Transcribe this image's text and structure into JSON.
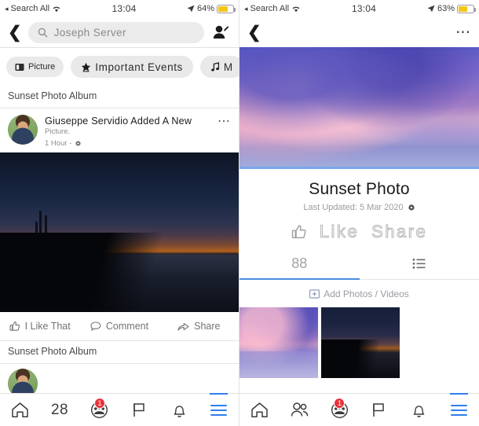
{
  "left": {
    "status": {
      "carrier": "Search All",
      "wifi_icon": "wifi-icon",
      "time": "13:04",
      "location_icon": "location-arrow-icon",
      "battery_pct": "64%",
      "battery_level": 64
    },
    "nav": {
      "back_icon": "chevron-left-icon",
      "search_value": "Joseph Server",
      "search_icon": "search-icon",
      "add_person_icon": "add-person-icon"
    },
    "chips": [
      {
        "label": "Picture",
        "icon": "picture-icon"
      },
      {
        "label": "Important Events",
        "icon": "star-icon"
      },
      {
        "label": "M",
        "icon": "music-note-icon"
      }
    ],
    "album_title": "Sunset Photo Album",
    "post": {
      "author_line": "Giuseppe Servidio Added A New",
      "author_line2": "Picture.",
      "time": "1 Hour  -",
      "privacy_icon": "gear-icon",
      "menu_icon": "more-options-icon",
      "avatar": "avatar"
    },
    "actions": [
      {
        "label": "I Like That",
        "icon": "thumbs-up-icon"
      },
      {
        "label": "Comment",
        "icon": "comment-icon"
      },
      {
        "label": "Share",
        "icon": "share-icon"
      }
    ],
    "album_title_2": "Sunset Photo Album",
    "bottomnav": [
      {
        "name": "home",
        "icon": "home-icon",
        "label": "",
        "badge": "",
        "active": false
      },
      {
        "name": "friends-count",
        "icon": "",
        "label": "28",
        "badge": "",
        "active": false
      },
      {
        "name": "groups",
        "icon": "groups-icon",
        "label": "",
        "badge": "1",
        "active": false
      },
      {
        "name": "pages",
        "icon": "flag-icon",
        "label": "",
        "badge": "",
        "active": false
      },
      {
        "name": "notifications",
        "icon": "bell-icon",
        "label": "",
        "badge": "",
        "active": false
      },
      {
        "name": "menu",
        "icon": "hamburger-icon",
        "label": "",
        "badge": "",
        "active": true
      }
    ]
  },
  "right": {
    "status": {
      "carrier": "Search All",
      "wifi_icon": "wifi-icon",
      "time": "13:04",
      "location_icon": "location-arrow-icon",
      "battery_pct": "63%",
      "battery_level": 63
    },
    "nav": {
      "back_icon": "chevron-left-icon",
      "menu_icon": "more-options-icon"
    },
    "detail": {
      "title": "Sunset Photo",
      "subtitle": "Last Updated: 5 Mar 2020",
      "subtitle_icon": "gear-icon",
      "like_label": "Like",
      "share_label": "Share",
      "like_icon": "thumbs-up-icon"
    },
    "tabs": [
      {
        "name": "count-tab",
        "label": "88",
        "icon": "",
        "active": true
      },
      {
        "name": "list-tab",
        "label": "",
        "icon": "list-icon",
        "active": false
      }
    ],
    "add_row": {
      "label": "Add Photos / Videos",
      "icon": "add-photo-icon"
    },
    "thumbnails": [
      {
        "name": "thumbnail-sunset-sky",
        "alt": "purple sunset over water"
      },
      {
        "name": "thumbnail-sunset-dusk",
        "alt": "dark sunset over shoreline"
      }
    ],
    "bottomnav": [
      {
        "name": "home",
        "icon": "home-icon",
        "label": "",
        "badge": "",
        "active": false
      },
      {
        "name": "friends",
        "icon": "friends-icon",
        "label": "",
        "badge": "",
        "active": false
      },
      {
        "name": "groups",
        "icon": "groups-icon",
        "label": "",
        "badge": "1",
        "active": false
      },
      {
        "name": "pages",
        "icon": "flag-icon",
        "label": "",
        "badge": "",
        "active": false
      },
      {
        "name": "notifications",
        "icon": "bell-icon",
        "label": "",
        "badge": "",
        "active": false
      },
      {
        "name": "menu",
        "icon": "hamburger-icon",
        "label": "",
        "badge": "",
        "active": true
      }
    ]
  },
  "colors": {
    "accent": "#2d7ff0",
    "badge": "#e8343c",
    "chip_bg": "#e9e9e9",
    "battery": "#f5c518"
  }
}
